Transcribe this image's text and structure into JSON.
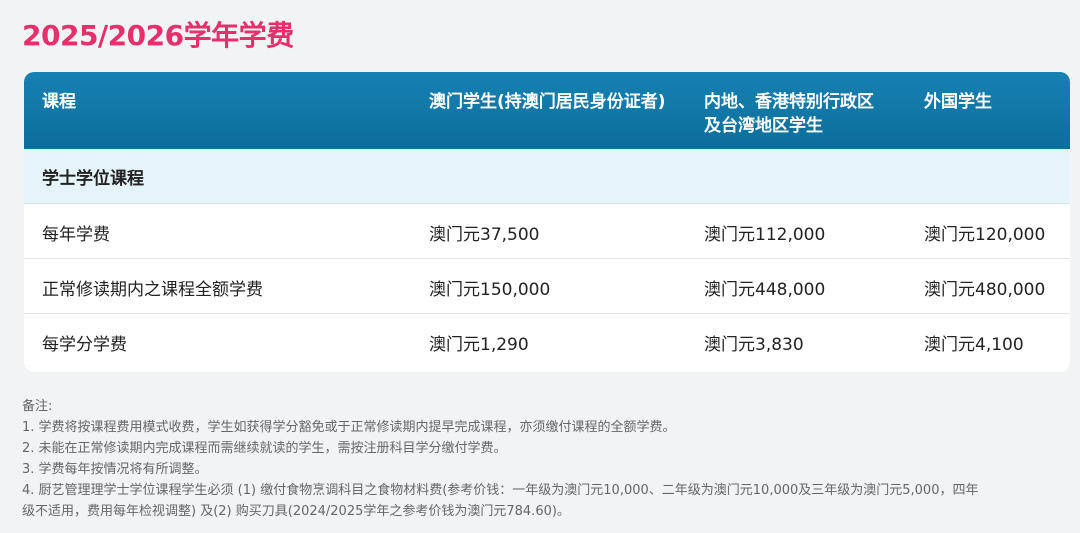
{
  "page_title": "2025/2026学年学费",
  "table": {
    "headers": [
      "课程",
      "澳门学生(持澳门居民身份证者)",
      "内地、香港特别行政区",
      "及台湾地区学生",
      "外国学生"
    ],
    "section": "学士学位课程",
    "rows": [
      [
        "每年学费",
        "澳门元37,500",
        "澳门元112,000",
        "澳门元120,000"
      ],
      [
        "正常修读期内之课程全额学费",
        "澳门元150,000",
        "澳门元448,000",
        "澳门元480,000"
      ],
      [
        "每学分学费",
        "澳门元1,290",
        "澳门元3,830",
        "澳门元4,100"
      ]
    ]
  },
  "notes": {
    "title": "备注:",
    "items": [
      "1. 学费将按课程费用模式收费，学生如获得学分豁免或于正常修读期内提早完成课程，亦须缴付课程的全额学费。",
      "2. 未能在正常修读期内完成课程而需继续就读的学生，需按注册科目学分缴付学费。",
      "3. 学费每年按情况将有所调整。",
      "4. 厨艺管理理学士学位课程学生必须 (1) 缴付食物烹调科目之食物材料费(参考价钱：一年级为澳门元10,000、二年级为澳门元10,000及三年级为澳门元5,000，四年",
      "级不适用，费用每年检视调整) 及(2) 购买刀具(2024/2025学年之参考价钱为澳门元784.60)。"
    ]
  }
}
